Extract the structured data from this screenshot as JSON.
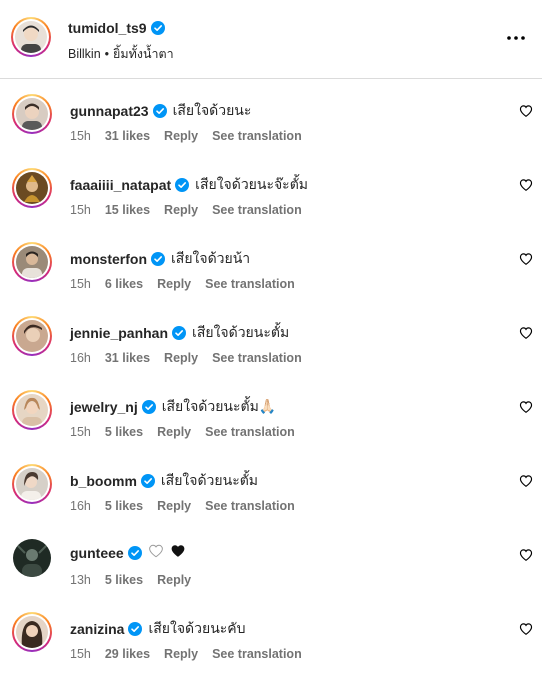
{
  "post": {
    "username": "tumidol_ts9",
    "song_artist": "Billkin",
    "song_title": "ยิ้มทั้งน้ำตา",
    "separator": "•"
  },
  "comments": [
    {
      "username": "gunnapat23",
      "text": "เสียใจด้วยนะ",
      "time": "15h",
      "likes": "31 likes",
      "reply": "Reply",
      "translate": "See translation",
      "avatar_color": "#c9b9ad"
    },
    {
      "username": "faaaiiii_natapat",
      "text": "เสียใจด้วยนะจ๊ะตั้ม",
      "time": "15h",
      "likes": "15 likes",
      "reply": "Reply",
      "translate": "See translation",
      "avatar_color": "#8a6a3a"
    },
    {
      "username": "monsterfon",
      "text": "เสียใจด้วยน้า",
      "time": "15h",
      "likes": "6 likes",
      "reply": "Reply",
      "translate": "See translation",
      "avatar_color": "#6b5a4a"
    },
    {
      "username": "jennie_panhan",
      "text": "เสียใจด้วยนะตั้ม",
      "time": "16h",
      "likes": "31 likes",
      "reply": "Reply",
      "translate": "See translation",
      "avatar_color": "#a78470"
    },
    {
      "username": "jewelry_nj",
      "text": "เสียใจด้วยนะตั้ม🙏🏻",
      "time": "15h",
      "likes": "5 likes",
      "reply": "Reply",
      "translate": "See translation",
      "avatar_color": "#c49a7a"
    },
    {
      "username": "b_boomm",
      "text": "เสียใจด้วยนะตั้ม",
      "time": "16h",
      "likes": "5 likes",
      "reply": "Reply",
      "translate": "See translation",
      "avatar_color": "#bfb7ae"
    },
    {
      "username": "gunteee",
      "text": "",
      "time": "13h",
      "likes": "5 likes",
      "reply": "Reply",
      "translate": "",
      "avatar_color": "#2d3a33"
    },
    {
      "username": "zanizina",
      "text": "เสียใจด้วยนะคับ",
      "time": "15h",
      "likes": "29 likes",
      "reply": "Reply",
      "translate": "See translation",
      "avatar_color": "#7a5a4a"
    }
  ],
  "colors": {
    "verified": "#0095f6",
    "meta": "#737373",
    "divider": "#dbdbdb"
  },
  "icons": {
    "more": "more-horizontal-icon",
    "like": "heart-outline-icon",
    "verified": "verified-badge-icon"
  }
}
